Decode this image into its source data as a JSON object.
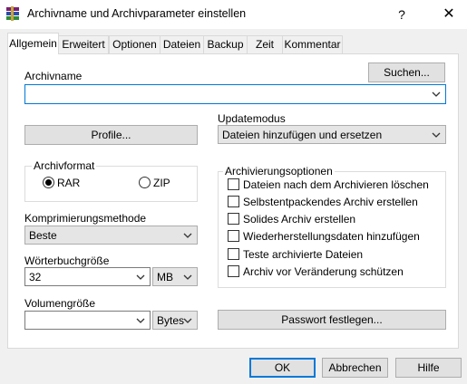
{
  "window": {
    "title": "Archivname und Archivparameter einstellen",
    "help_glyph": "?",
    "close_glyph": "✕"
  },
  "tabs": [
    {
      "label": "Allgemein",
      "active": true
    },
    {
      "label": "Erweitert",
      "active": false
    },
    {
      "label": "Optionen",
      "active": false
    },
    {
      "label": "Dateien",
      "active": false
    },
    {
      "label": "Backup",
      "active": false
    },
    {
      "label": "Zeit",
      "active": false
    },
    {
      "label": "Kommentar",
      "active": false
    }
  ],
  "archive_name": {
    "label": "Archivname",
    "value": "",
    "browse_label": "Suchen..."
  },
  "update_mode": {
    "label": "Updatemodus",
    "value": "Dateien hinzufügen und ersetzen"
  },
  "profile_button": "Profile...",
  "archive_format": {
    "label": "Archivformat",
    "options": [
      {
        "label": "RAR",
        "selected": true
      },
      {
        "label": "ZIP",
        "selected": false
      }
    ]
  },
  "compression": {
    "label": "Komprimierungsmethode",
    "value": "Beste"
  },
  "dictionary": {
    "label": "Wörterbuchgröße",
    "value": "32",
    "unit": "MB"
  },
  "volume": {
    "label": "Volumengröße",
    "value": "",
    "unit": "Bytes"
  },
  "archiving_options": {
    "label": "Archivierungsoptionen",
    "items": [
      {
        "label": "Dateien nach dem Archivieren löschen",
        "checked": false
      },
      {
        "label": "Selbstentpackendes Archiv erstellen",
        "checked": false
      },
      {
        "label": "Solides Archiv erstellen",
        "checked": false
      },
      {
        "label": "Wiederherstellungsdaten hinzufügen",
        "checked": false
      },
      {
        "label": "Teste archivierte Dateien",
        "checked": false
      },
      {
        "label": "Archiv vor Veränderung schützen",
        "checked": false
      }
    ]
  },
  "password_button": "Passwort festlegen...",
  "footer": {
    "ok": "OK",
    "cancel": "Abbrechen",
    "help": "Hilfe"
  },
  "colors": {
    "accent": "#0078d7",
    "dialog_bg": "#f0f0f0",
    "panel_bg": "#ffffff"
  }
}
